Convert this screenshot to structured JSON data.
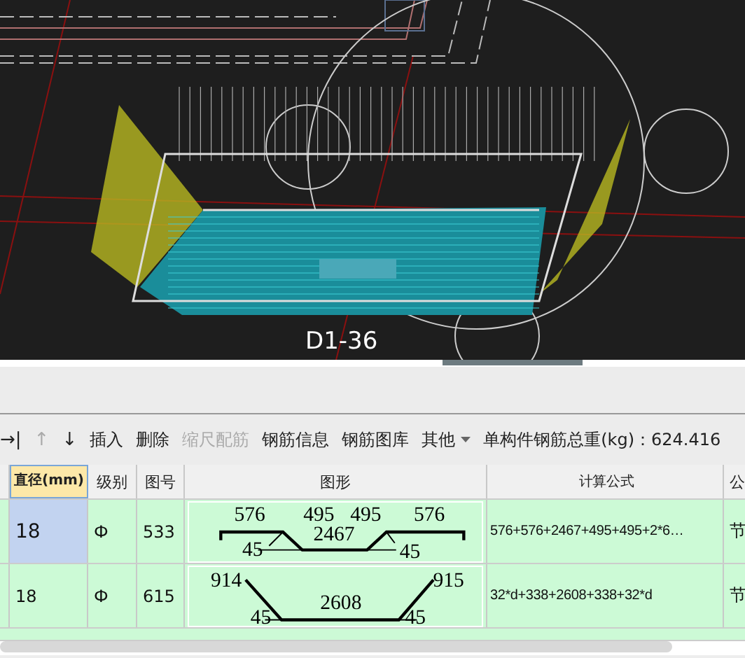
{
  "viewport": {
    "label": "D1-36"
  },
  "toolbar": {
    "items": [
      {
        "kind": "icon",
        "label": "→|",
        "disabled": false
      },
      {
        "kind": "icon",
        "label": "↑",
        "disabled": true
      },
      {
        "kind": "icon",
        "label": "↓",
        "disabled": false
      },
      {
        "kind": "text",
        "label": "插入",
        "disabled": false
      },
      {
        "kind": "text",
        "label": "删除",
        "disabled": false
      },
      {
        "kind": "text",
        "label": "缩尺配筋",
        "disabled": true
      },
      {
        "kind": "text",
        "label": "钢筋信息",
        "disabled": false
      },
      {
        "kind": "text",
        "label": "钢筋图库",
        "disabled": false
      },
      {
        "kind": "menu",
        "label": "其他",
        "disabled": false
      }
    ],
    "total_weight": "单构件钢筋总重(kg)：624.416"
  },
  "table": {
    "columns": [
      "直径(mm)",
      "级别",
      "图号",
      "图形",
      "计算公式",
      "公"
    ],
    "rows": [
      {
        "diameter": "18",
        "grade": "Ф",
        "shape_no": "533",
        "selected": true,
        "shape": {
          "kind": "hooked-trough",
          "labels": [
            "576",
            "495",
            "495",
            "576",
            "45",
            "2467",
            "45"
          ]
        },
        "formula": "576+576+2467+495+495+2*6…",
        "column_6": "节"
      },
      {
        "diameter": "18",
        "grade": "Ф",
        "shape_no": "615",
        "selected": false,
        "shape": {
          "kind": "trough",
          "labels": [
            "914",
            "915",
            "45",
            "2608",
            "45"
          ]
        },
        "formula": "32*d+338+2608+338+32*d",
        "column_6": "节"
      }
    ]
  }
}
